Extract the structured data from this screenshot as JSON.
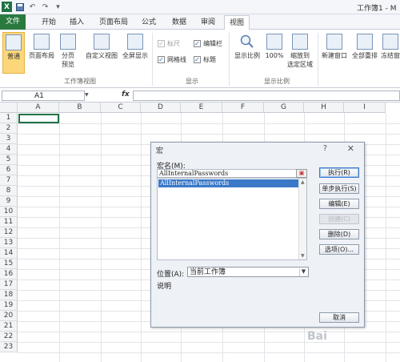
{
  "window": {
    "title": "工作簿1 - M"
  },
  "qat": {
    "undo_label": "↶",
    "redo_label": "↷"
  },
  "tabs": [
    {
      "label": "文件"
    },
    {
      "label": "开始"
    },
    {
      "label": "插入"
    },
    {
      "label": "页面布局"
    },
    {
      "label": "公式"
    },
    {
      "label": "数据"
    },
    {
      "label": "审阅"
    },
    {
      "label": "视图"
    }
  ],
  "ribbon": {
    "workbook_views": {
      "group_label": "工作簿视图",
      "normal": "普通",
      "page_layout": "页面布局",
      "page_break_line1": "分页",
      "page_break_line2": "预览",
      "custom_views": "自定义视图",
      "full_screen": "全屏显示"
    },
    "show": {
      "group_label": "显示",
      "ruler": "标尺",
      "formula_bar": "编辑栏",
      "gridlines": "网格线",
      "headings": "标题"
    },
    "zoom": {
      "group_label": "显示比例",
      "zoom": "显示比例",
      "hundred": "100%",
      "zoom_sel_line1": "缩放到",
      "zoom_sel_line2": "选定区域"
    },
    "window": {
      "new_window": "新建窗口",
      "arrange_all": "全部重排",
      "freeze": "冻结窗"
    }
  },
  "formula_bar": {
    "name_box": "A1",
    "fx": "fx"
  },
  "grid": {
    "columns": [
      "A",
      "B",
      "C",
      "D",
      "E",
      "F",
      "G",
      "H",
      "I"
    ],
    "rows": [
      "1",
      "2",
      "3",
      "4",
      "5",
      "6",
      "7",
      "8",
      "9",
      "10",
      "11",
      "12",
      "13",
      "14",
      "15",
      "16",
      "17",
      "18",
      "19",
      "20",
      "21",
      "22",
      "23"
    ]
  },
  "dialog": {
    "title": "宏",
    "help": "?",
    "close": "✕",
    "macro_name_label": "宏名(M):",
    "macro_name_value": "AllInternalPasswords",
    "macros": [
      "AllInternalPasswords"
    ],
    "buttons": {
      "run": "执行(R)",
      "step_into": "单步执行(S)",
      "edit": "编辑(E)",
      "create": "创建(C)",
      "delete": "删除(D)",
      "options": "选项(O)...",
      "cancel": "取消"
    },
    "location_label": "位置(A):",
    "location_value": "当前工作簿",
    "description_label": "说明"
  },
  "watermark": "Bai"
}
